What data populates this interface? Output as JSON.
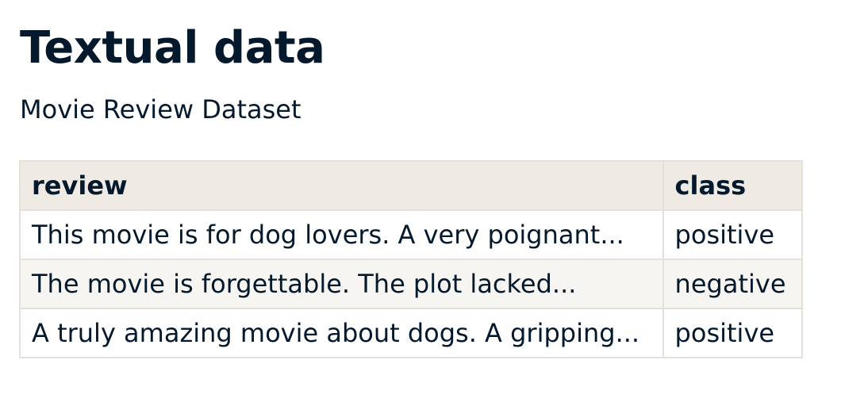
{
  "page": {
    "title": "Textual data",
    "subtitle": "Movie Review Dataset"
  },
  "table": {
    "columns": [
      "review",
      "class"
    ],
    "rows": [
      [
        "This movie is for dog lovers. A very poignant...",
        "positive"
      ],
      [
        "The movie is forgettable. The plot lacked...",
        "negative"
      ],
      [
        "A truly amazing movie about dogs. A gripping...",
        "positive"
      ]
    ]
  }
}
